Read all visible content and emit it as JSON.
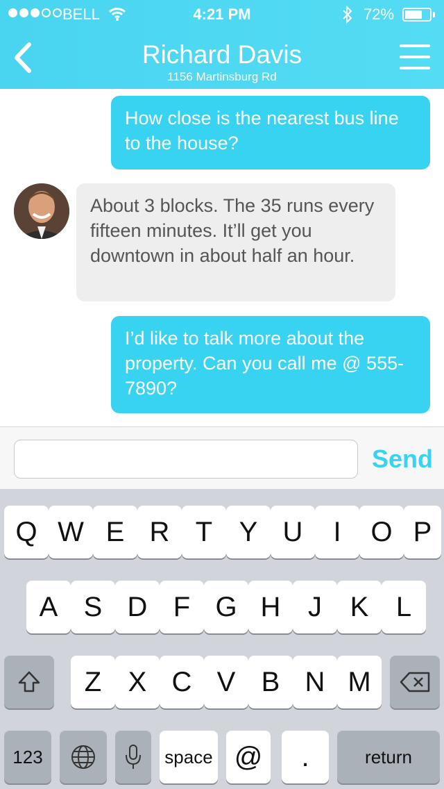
{
  "status_bar": {
    "carrier": "BELL",
    "time": "4:21 PM",
    "battery_percent": "72%",
    "battery_level": 0.72,
    "signal_bars": 3,
    "signal_total": 5
  },
  "nav": {
    "title": "Richard Davis",
    "subtitle": "1156 Martinsburg Rd",
    "back_icon": "chevron-left-icon",
    "menu_icon": "hamburger-menu-icon"
  },
  "messages": [
    {
      "direction": "outgoing",
      "text": "How close is the nearest bus line to the house?"
    },
    {
      "direction": "incoming",
      "text": "About 3 blocks. The 35 runs every fifteen minutes. It’ll get you downtown in about half an hour."
    },
    {
      "direction": "outgoing",
      "text": "I’d like to talk more about the property. Can you call me @ 555-7890?"
    }
  ],
  "composer": {
    "input_value": "",
    "send_label": "Send"
  },
  "keyboard": {
    "row1": [
      "Q",
      "W",
      "E",
      "R",
      "T",
      "Y",
      "U",
      "I",
      "O",
      "P"
    ],
    "row2": [
      "A",
      "S",
      "D",
      "F",
      "G",
      "H",
      "J",
      "K",
      "L"
    ],
    "row3": [
      "Z",
      "X",
      "C",
      "V",
      "B",
      "N",
      "M"
    ],
    "numbers_label": "123",
    "space_label": "space",
    "at_label": "@",
    "period_label": ".",
    "return_label": "return"
  },
  "colors": {
    "accent": "#38d3f0",
    "header": "#4fd8f2",
    "incoming_bubble": "#eeeeee",
    "keyboard_bg": "#d1d5db"
  }
}
